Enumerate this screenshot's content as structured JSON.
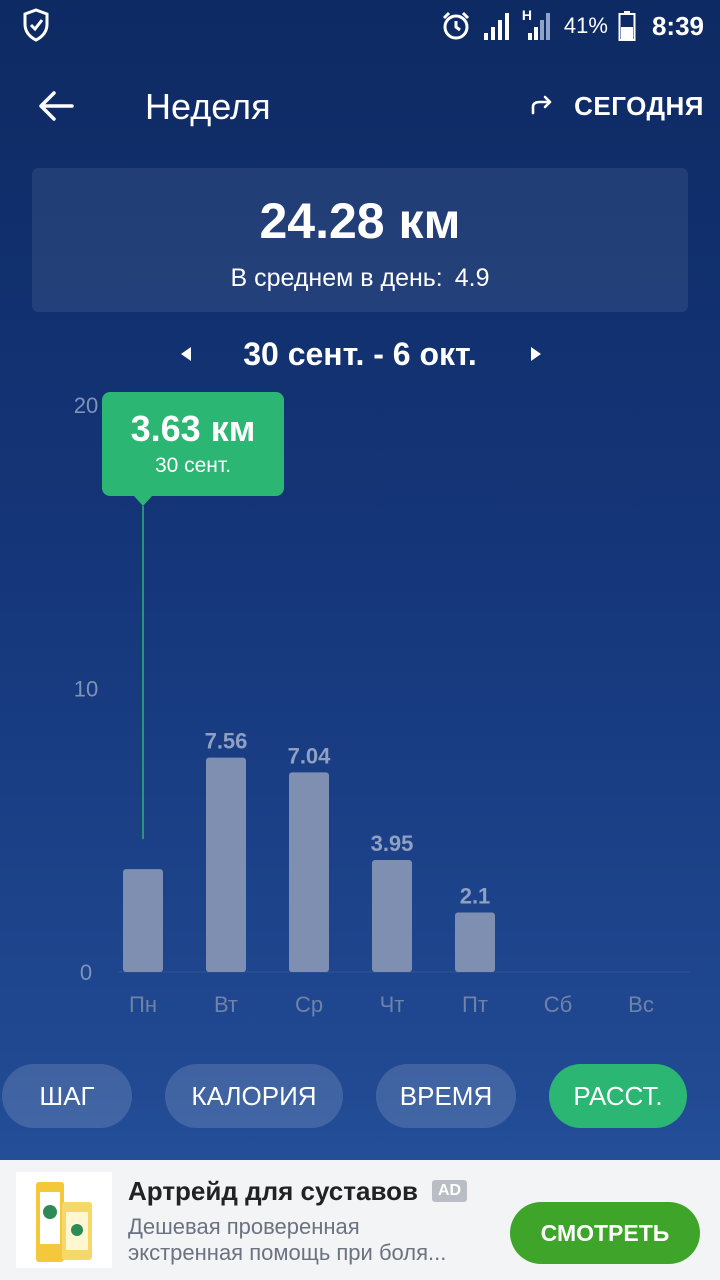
{
  "status_bar": {
    "network_type": "H",
    "battery": "41%",
    "time": "8:39"
  },
  "app_bar": {
    "title": "Неделя",
    "today_label": "СЕГОДНЯ"
  },
  "summary": {
    "total": "24.28 км",
    "avg_label": "В среднем в день:",
    "avg_value": "4.9"
  },
  "range": {
    "text": "30 сент. - 6 окт."
  },
  "tooltip": {
    "value": "3.63 км",
    "date": "30 сент."
  },
  "chart_data": {
    "type": "bar",
    "categories": [
      "Пн",
      "Вт",
      "Ср",
      "Чт",
      "Пт",
      "Сб",
      "Вс"
    ],
    "values": [
      3.63,
      7.56,
      7.04,
      3.95,
      2.1,
      null,
      null
    ],
    "value_labels": [
      "",
      "7.56",
      "7.04",
      "3.95",
      "2.1",
      "",
      ""
    ],
    "yticks": [
      "0",
      "10",
      "20"
    ],
    "ylim": [
      0,
      20
    ],
    "selected_index": 0,
    "bar_color": "#7e8fb1",
    "highlight_color": "#2bb673"
  },
  "tabs": [
    {
      "label": "ШАГ",
      "active": false
    },
    {
      "label": "КАЛОРИЯ",
      "active": false
    },
    {
      "label": "ВРЕМЯ",
      "active": false
    },
    {
      "label": "РАССТ.",
      "active": true
    }
  ],
  "ad": {
    "headline": "Артрейд для суставов",
    "badge": "AD",
    "body_line1": "Дешевая проверенная",
    "body_line2": "экстренная помощь при боля...",
    "cta": "СМОТРЕТЬ"
  },
  "colors": {
    "accent": "#2bb673",
    "cta_green": "#3fa52a"
  }
}
